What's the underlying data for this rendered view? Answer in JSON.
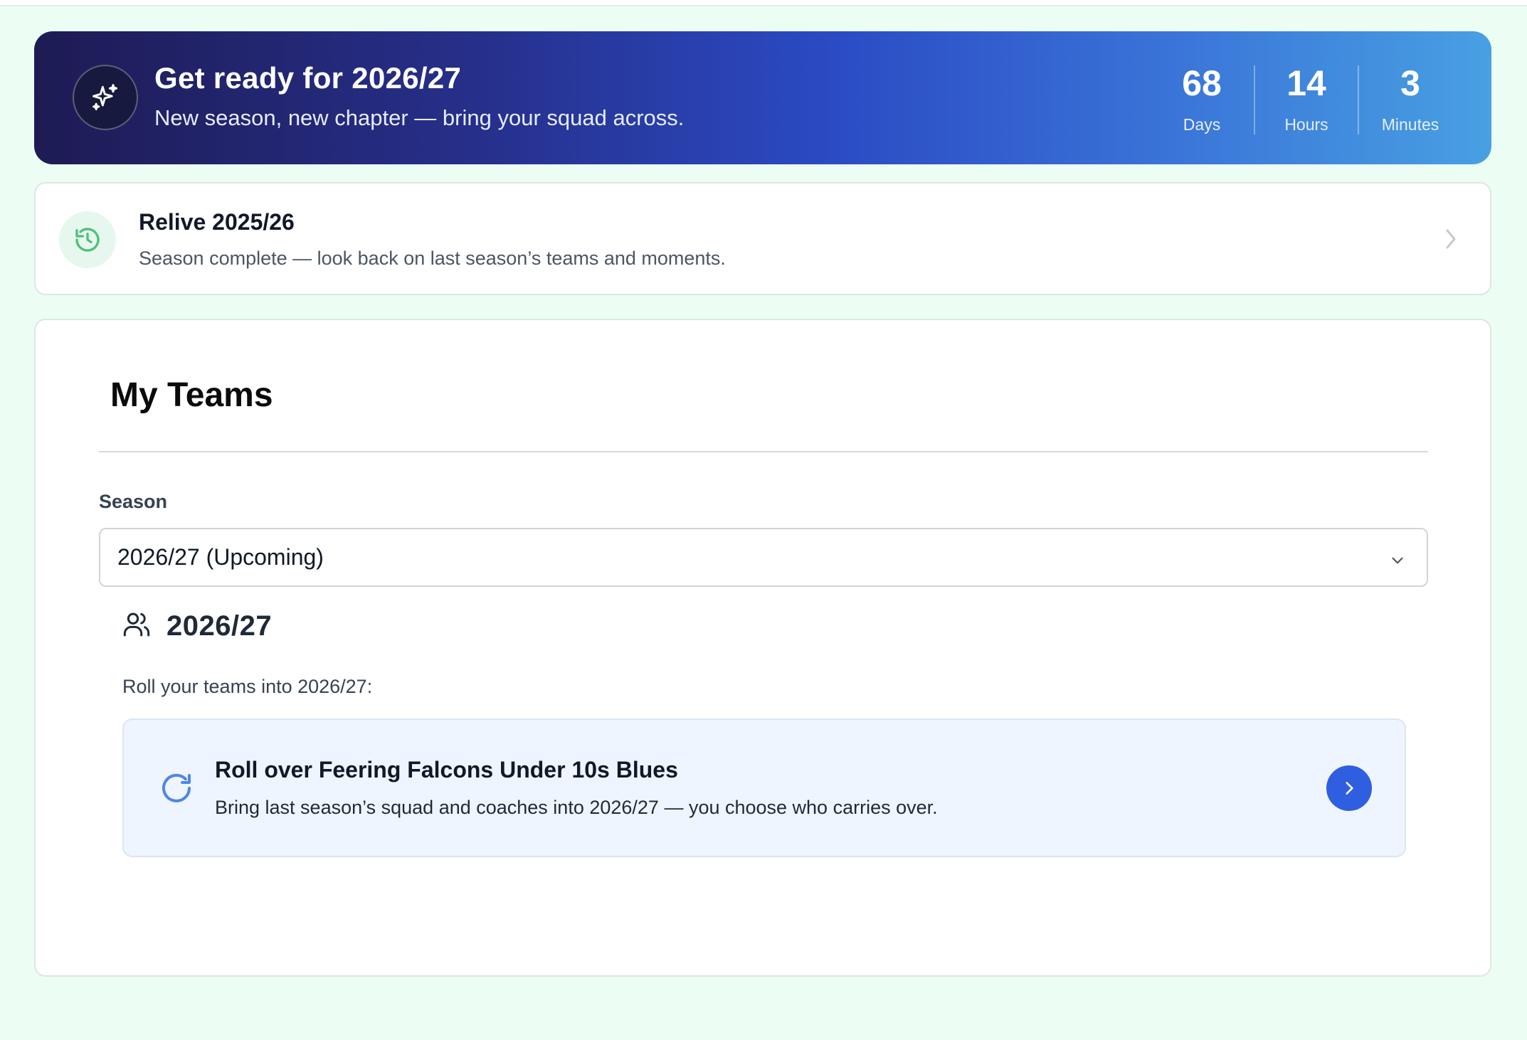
{
  "banner": {
    "icon": "sparkles-icon",
    "title": "Get ready for 2026/27",
    "subtitle": "New season, new chapter — bring your squad across.",
    "countdown": [
      {
        "value": "68",
        "label": "Days"
      },
      {
        "value": "14",
        "label": "Hours"
      },
      {
        "value": "3",
        "label": "Minutes"
      }
    ],
    "gradient_colors": [
      "#1e1b54",
      "#2b4bc4",
      "#48a0e2"
    ]
  },
  "relive": {
    "icon": "history-icon",
    "title": "Relive 2025/26",
    "subtitle": "Season complete — look back on last season’s teams and moments.",
    "accent_color": "#4fbf7e"
  },
  "teams": {
    "title": "My Teams",
    "season_label": "Season",
    "season_selected": "2026/27 (Upcoming)",
    "year_heading": "2026/27",
    "roll_prompt": "Roll your teams into 2026/27:",
    "rollover": {
      "icon": "refresh-icon",
      "title": "Roll over Feering Falcons Under 10s Blues",
      "subtitle": "Bring last season’s squad and coaches into 2026/27 — you choose who carries over.",
      "button_color": "#2f5fe0"
    }
  }
}
